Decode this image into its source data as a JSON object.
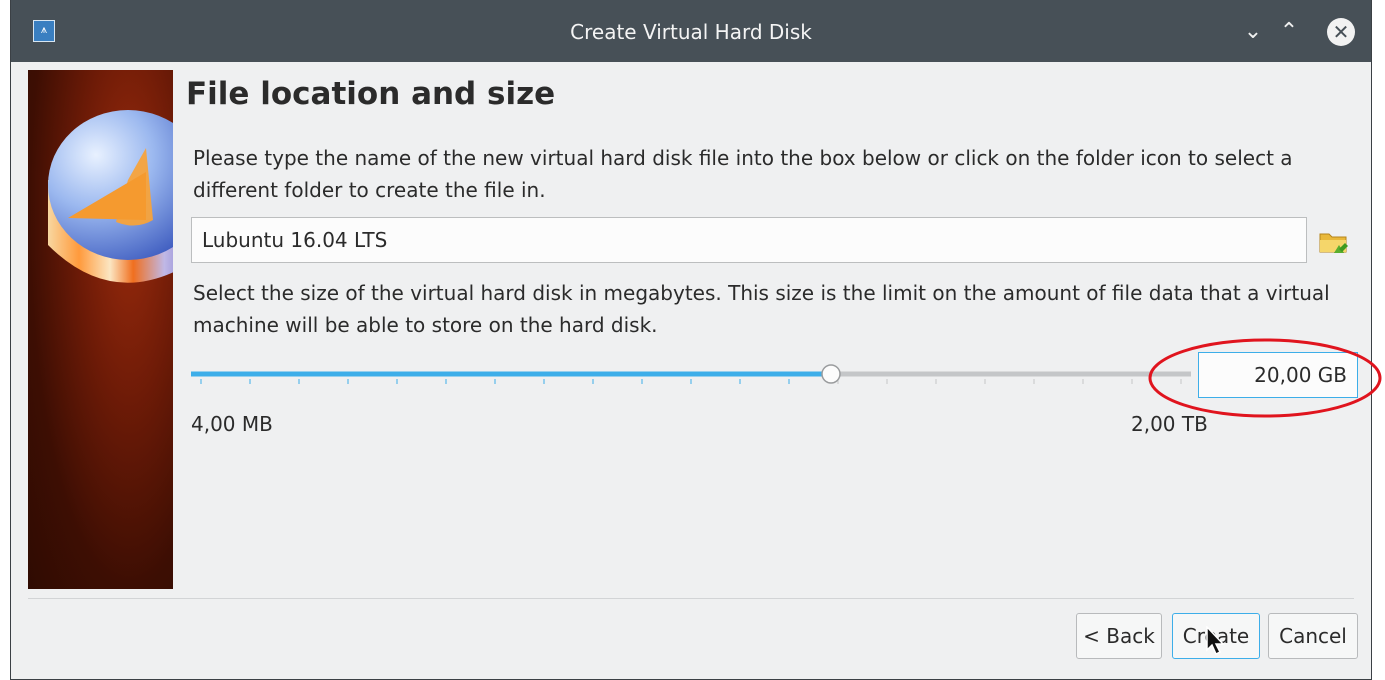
{
  "window": {
    "title": "Create Virtual Hard Disk",
    "controls": {
      "minimize": "⌄",
      "maximize": "⌃",
      "close": "✕"
    }
  },
  "page": {
    "heading": "File location and size",
    "file_instructions": "Please type the name of the new virtual hard disk file into the box below or click on the folder icon to select a different folder to create the file in.",
    "file_name_value": "Lubuntu 16.04 LTS",
    "size_instructions": "Select the size of the virtual hard disk in megabytes. This size is the limit on the amount of file data that a virtual machine will be able to store on the hard disk.",
    "slider": {
      "min_label": "4,00 MB",
      "max_label": "2,00 TB",
      "position_fraction": 0.64
    },
    "size_value": "20,00 GB"
  },
  "buttons": {
    "back": "< Back",
    "create": "Create",
    "cancel": "Cancel"
  },
  "colors": {
    "titlebar": "#475057",
    "accent": "#3daee9",
    "annotation": "#e0141e",
    "banner_dark": "#3d0e03"
  },
  "icons": {
    "folder": "folder-open-icon",
    "app": "virtualbox-icon"
  }
}
